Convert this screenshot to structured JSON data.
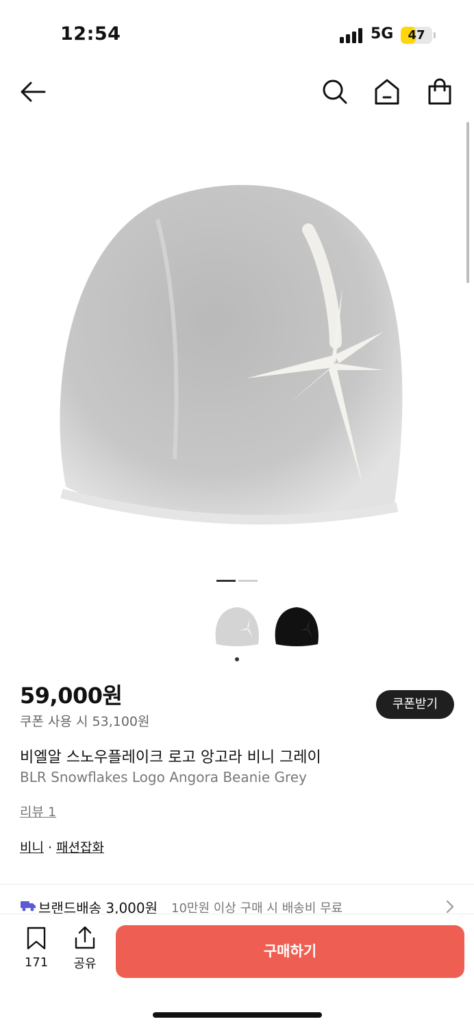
{
  "status_bar": {
    "time": "12:54",
    "network": "5G",
    "battery": "47",
    "battery_level": 0.47
  },
  "nav": {
    "back_icon": "arrow-left-icon",
    "search_icon": "search-icon",
    "home_icon": "home-icon",
    "cart_icon": "shopping-bag-icon"
  },
  "gallery": {
    "slide_count": 2,
    "active_slide": 1,
    "thumbnails": [
      {
        "color": "grey",
        "selected": true
      },
      {
        "color": "black",
        "selected": false
      }
    ]
  },
  "product": {
    "price": "59,000원",
    "coupon_price": "쿠폰 사용 시 53,100원",
    "coupon_button": "쿠폰받기",
    "name_ko": "비엘알 스노우플레이크 로고 앙고라 비니 그레이",
    "name_en": "BLR Snowflakes Logo Angora Beanie Grey",
    "review_link": "리뷰 1",
    "categories": [
      "비니",
      "패션잡화"
    ],
    "category_separator": "·"
  },
  "shipping": {
    "icon": "truck-icon",
    "label": "브랜드배송 3,000원",
    "note": "10만원 이상 구매 시 배송비 무료"
  },
  "bottom_bar": {
    "wish_count": "171",
    "share_label": "공유",
    "buy_label": "구매하기"
  },
  "colors": {
    "accent": "#ef5e52",
    "dark_button": "#1f1f1f",
    "battery": "#ffd60a"
  }
}
